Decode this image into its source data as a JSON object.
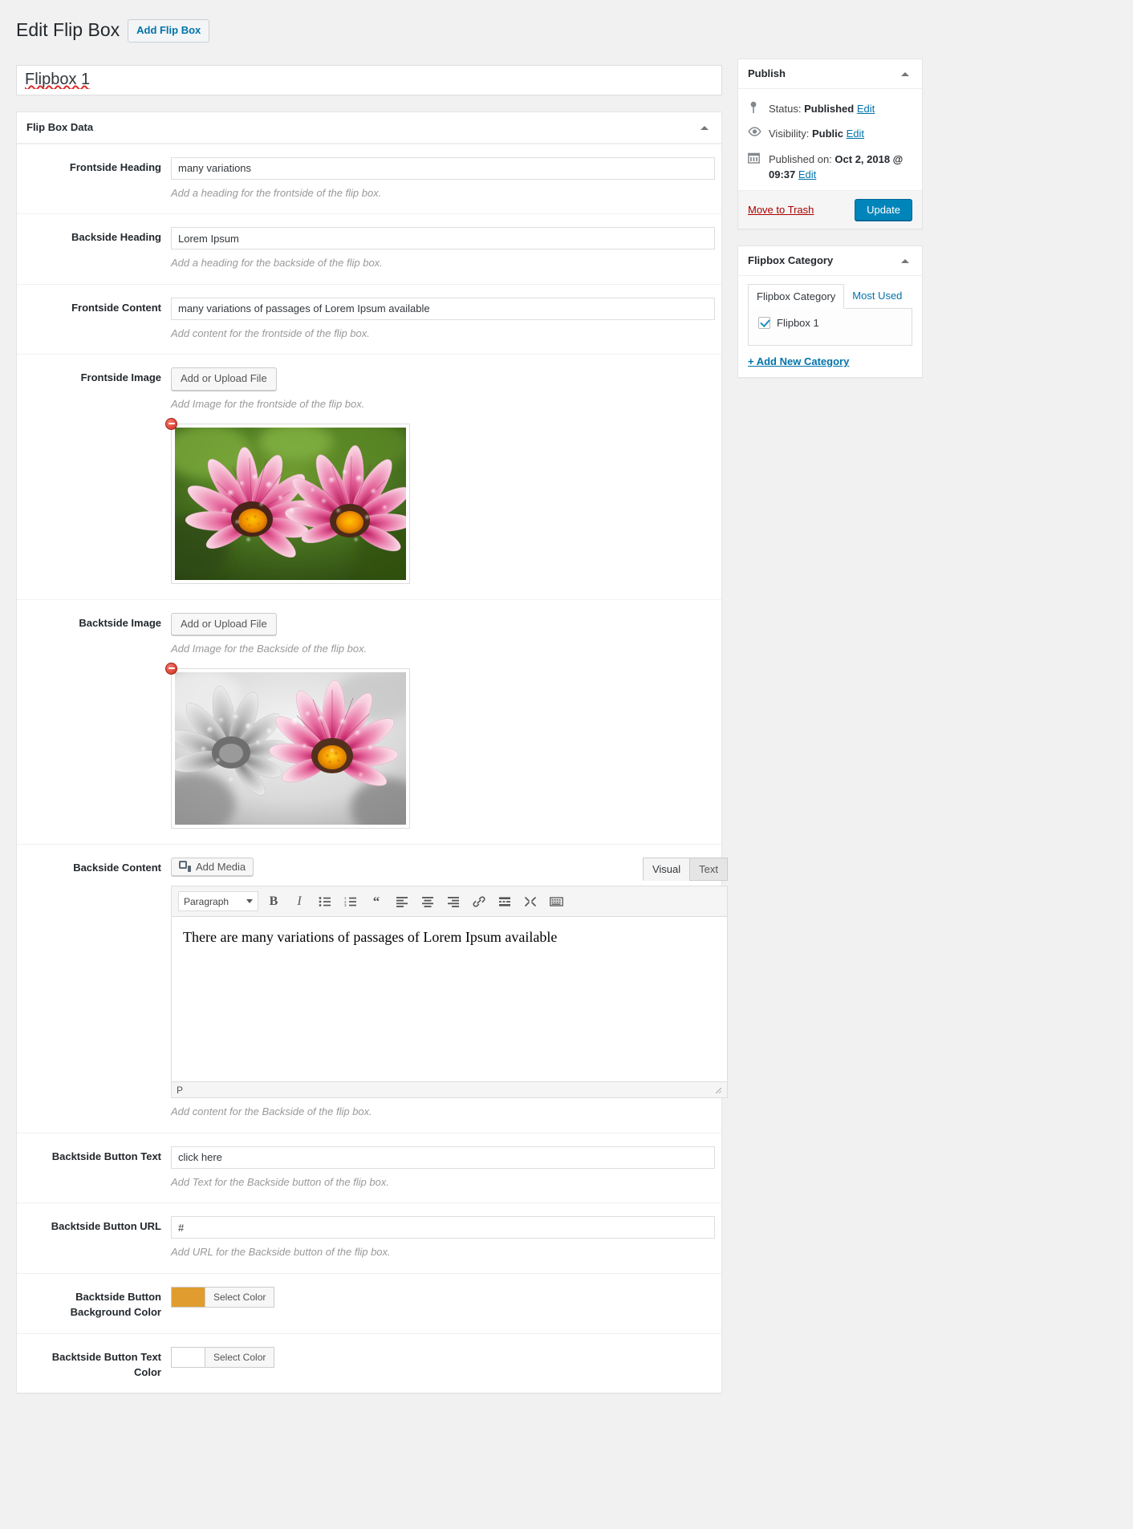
{
  "header": {
    "title": "Edit Flip Box",
    "add_button": "Add Flip Box"
  },
  "post_title": {
    "value": "Flipbox 1"
  },
  "metabox": {
    "title": "Flip Box Data",
    "fields": [
      {
        "label": "Frontside Heading",
        "value": "many variations",
        "desc": "Add a heading for the frontside of the flip box."
      },
      {
        "label": "Backside Heading",
        "value": "Lorem Ipsum",
        "desc": "Add a heading for the backside of the flip box."
      },
      {
        "label": "Frontside Content",
        "value": "many variations of passages of Lorem Ipsum available",
        "desc": "Add content for the frontside of the flip box."
      }
    ],
    "frontside_image": {
      "label": "Frontside Image",
      "button": "Add or Upload File",
      "desc": "Add Image for the frontside of the flip box.",
      "remove_title": "Remove image"
    },
    "backside_image": {
      "label": "Backtside Image",
      "button": "Add or Upload File",
      "desc": "Add Image for the Backside of the flip box.",
      "remove_title": "Remove image"
    },
    "backside_content": {
      "label": "Backside Content",
      "add_media": "Add Media",
      "tab_visual": "Visual",
      "tab_text": "Text",
      "format_select": "Paragraph",
      "body_text": "There are many variations of passages of Lorem Ipsum available",
      "path_indicator": "P",
      "desc": "Add content for the Backside of the flip box.",
      "toolbar_buttons": [
        "bold-icon",
        "italic-icon",
        "bulleted-list-icon",
        "numbered-list-icon",
        "blockquote-icon",
        "align-left-icon",
        "align-center-icon",
        "align-right-icon",
        "insert-link-icon",
        "read-more-icon",
        "fullscreen-icon",
        "toolbar-toggle-icon"
      ]
    },
    "button_text": {
      "label": "Backtside Button Text",
      "value": "click here",
      "desc": "Add Text for the Backside button of the flip box."
    },
    "button_url": {
      "label": "Backtside Button URL",
      "value": "#",
      "desc": "Add URL for the Backside button of the flip box."
    },
    "button_bg_color": {
      "label": "Backtside Button Background Color",
      "select_label": "Select Color",
      "color": "#e09c2e"
    },
    "button_text_color": {
      "label": "Backtside Button Text Color",
      "select_label": "Select Color",
      "color": "#ffffff"
    }
  },
  "sidebar": {
    "publish": {
      "title": "Publish",
      "status_label": "Status:",
      "status_value": "Published",
      "status_edit": "Edit",
      "visibility_label": "Visibility:",
      "visibility_value": "Public",
      "visibility_edit": "Edit",
      "published_label": "Published on:",
      "published_value": "Oct 2, 2018 @ 09:37",
      "published_edit": "Edit",
      "trash": "Move to Trash",
      "update": "Update"
    },
    "category": {
      "title": "Flipbox Category",
      "tab_all": "Flipbox Category",
      "tab_most_used": "Most Used",
      "items": [
        {
          "label": "Flipbox 1",
          "checked": true
        }
      ],
      "add_new": "+ Add New Category"
    }
  }
}
